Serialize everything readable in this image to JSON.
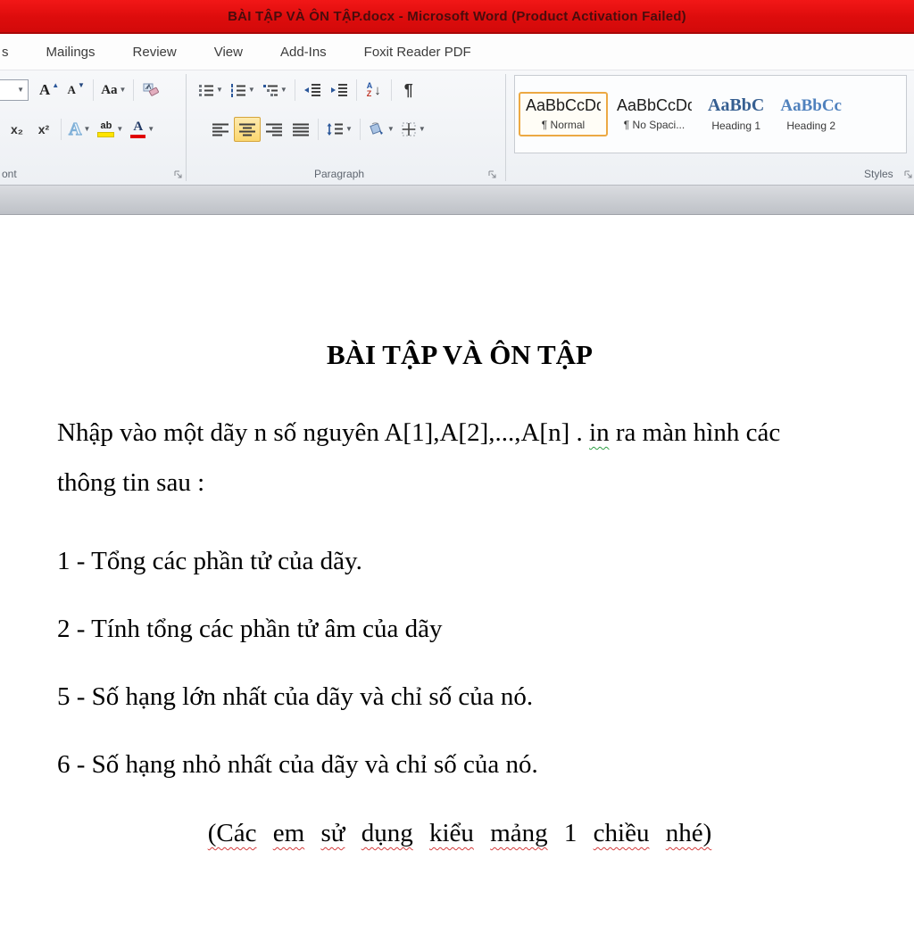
{
  "title_bar": {
    "text": "BÀI TẬP VÀ ÔN TẬP.docx - Microsoft Word (Product Activation Failed)"
  },
  "colors": {
    "titlebar_red": "#dd0c0c",
    "selection_orange": "#eca943",
    "heading1_blue": "#365f91",
    "heading2_blue": "#4f81bd",
    "squiggle_red": "#d43c3c",
    "squiggle_green": "#2e9e44",
    "highlight_yellow": "#ffe400",
    "font_color_red": "#e00000"
  },
  "ribbon": {
    "tabs": [
      "s",
      "Mailings",
      "Review",
      "View",
      "Add-Ins",
      "Foxit Reader PDF"
    ],
    "font_group": {
      "label": "ont",
      "grow_font": "A",
      "shrink_font": "A",
      "change_case": "Aa",
      "subscript": "x₂",
      "superscript": "x²",
      "text_effects": "A",
      "highlight": "ab",
      "font_color": "A"
    },
    "paragraph_group": {
      "label": "Paragraph",
      "sort_a": "A",
      "sort_z": "Z",
      "pilcrow": "¶"
    },
    "styles_group": {
      "label": "Styles",
      "items": [
        {
          "preview": "AaBbCcDd",
          "name": "¶ Normal"
        },
        {
          "preview": "AaBbCcDd",
          "name": "¶ No Spaci..."
        },
        {
          "preview": "AaBbC",
          "name": "Heading 1"
        },
        {
          "preview": "AaBbCc",
          "name": "Heading 2"
        }
      ]
    }
  },
  "document": {
    "title": "BÀI TẬP VÀ ÔN TẬP",
    "paragraph": {
      "line1_pre": "Nhập vào một dãy n số nguyên A[1],A[2],...,A[n] . ",
      "misspelled": "in",
      "line1_post": " ra màn hình các",
      "line2": "thông tin sau :"
    },
    "items": [
      "1 - Tổng các phần tử của dãy.",
      "2 - Tính tổng các phần tử âm của dãy",
      "5 - Số hạng lớn nhất của dãy và chỉ số của nó.",
      "6 - Số hạng nhỏ nhất của dãy và chỉ số của nó."
    ],
    "footer": {
      "words": [
        "(Các",
        "em",
        "sử",
        "dụng",
        "kiểu",
        "mảng",
        "1",
        "chiều",
        "nhé)"
      ]
    }
  }
}
